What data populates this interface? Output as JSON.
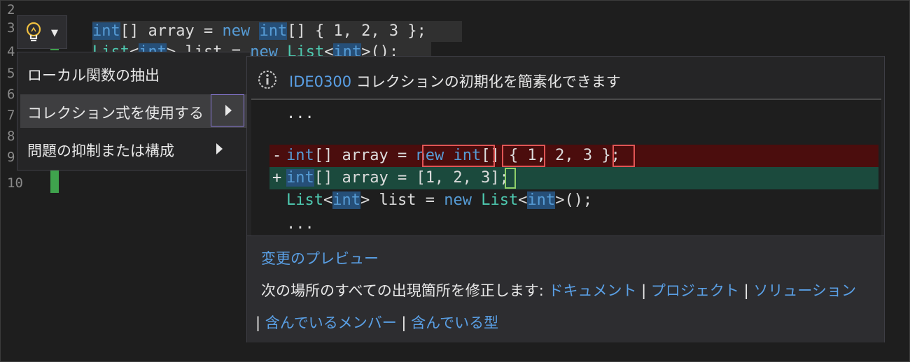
{
  "editor": {
    "line_numbers": [
      "2",
      "3",
      "4",
      "5",
      "6",
      "7",
      "8",
      "9",
      "10"
    ],
    "line3": {
      "int1": "int",
      "rest1": "[] array = ",
      "new": "new",
      "sp": " ",
      "int2": "int",
      "rest2": "[] { 1, 2, 3 };"
    },
    "line4": {
      "list": "List",
      "lt": "<",
      "int": "int",
      "gt": ">",
      "mid": " list = ",
      "new": "new",
      "sp": " ",
      "list2": "List",
      "lt2": "<",
      "int2": "int",
      "gt2": ">",
      "end": "();"
    }
  },
  "menu": {
    "items": [
      {
        "label": "ローカル関数の抽出"
      },
      {
        "label": "コレクション式を使用する"
      },
      {
        "label": "問題の抑制または構成"
      }
    ]
  },
  "preview": {
    "id": "IDE0300",
    "title": "コレクションの初期化を簡素化できます",
    "ellipsis": "...",
    "del": {
      "sign": "-",
      "int": "int",
      "a": "[] array = ",
      "new": "new",
      "sp": " ",
      "int2": "int",
      "b": "[] { 1, 2, 3 };"
    },
    "add": {
      "sign": "+",
      "int": "int",
      "a": "[] array = [1, 2, 3];"
    },
    "ctx": {
      "list": "List",
      "lt": "<",
      "int": "int",
      "gt": ">",
      "mid": " list = ",
      "new": "new",
      "sp": " ",
      "list2": "List",
      "lt2": "<",
      "int2": "int",
      "gt2": ">",
      "end": "();"
    }
  },
  "footer": {
    "preview_link": "変更のプレビュー",
    "fix_all": "次の場所のすべての出現箇所を修正します: ",
    "document": "ドキュメント",
    "project": "プロジェクト",
    "solution": "ソリューション",
    "member": "含んでいるメンバー",
    "type": "含んでいる型",
    "separator": "|"
  }
}
